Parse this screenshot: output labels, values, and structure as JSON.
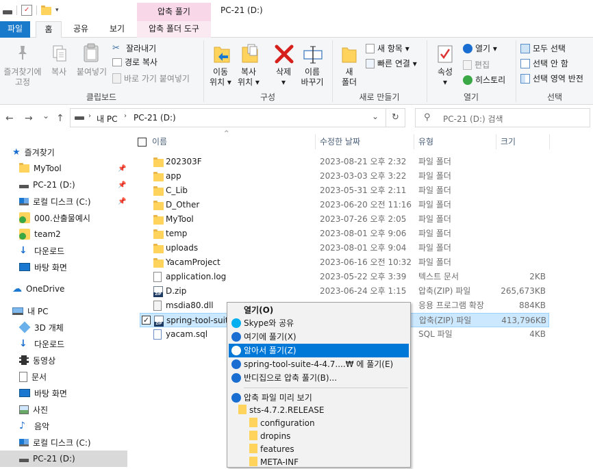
{
  "window": {
    "context_tab_group": "압축 풀기",
    "title": "PC-21 (D:)"
  },
  "tabs": [
    {
      "label": "파일"
    },
    {
      "label": "홈"
    },
    {
      "label": "공유"
    },
    {
      "label": "보기"
    },
    {
      "label": "압축 폴더 도구"
    }
  ],
  "ribbon": {
    "clipboard": {
      "pin_line1": "즐겨찾기에",
      "pin_line2": "고정",
      "copy": "복사",
      "paste": "붙여넣기",
      "cut": "잘라내기",
      "copy_path": "경로 복사",
      "paste_shortcut": "바로 가기 붙여넣기",
      "group": "클립보드"
    },
    "organize": {
      "move_line1": "이동",
      "move_line2": "위치 ▾",
      "copyto_line1": "복사",
      "copyto_line2": "위치 ▾",
      "delete_line1": "삭제",
      "delete_line2": "▾",
      "rename_line1": "이름",
      "rename_line2": "바꾸기",
      "group": "구성"
    },
    "new": {
      "folder_line1": "새",
      "folder_line2": "폴더",
      "new_item": "새 항목 ▾",
      "easy_access": "빠른 연결 ▾",
      "group": "새로 만들기"
    },
    "open": {
      "props_line1": "속성",
      "props_line2": "▾",
      "open": "열기 ▾",
      "edit": "편집",
      "history": "히스토리",
      "group": "열기"
    },
    "select": {
      "select_all": "모두 선택",
      "select_none": "선택 안 함",
      "invert": "선택 영역 반전",
      "group": "선택"
    }
  },
  "address": {
    "back": "←",
    "forward": "→",
    "recent": "⌄",
    "up": "↑",
    "crumb1": "내 PC",
    "crumb2": "PC-21 (D:)",
    "dropdown": "⌄",
    "refresh": "↻",
    "search_placeholder": "PC-21 (D:) 검색"
  },
  "nav": {
    "quick_access": "즐겨찾기",
    "items": [
      {
        "label": "MyTool"
      },
      {
        "label": "PC-21 (D:)"
      },
      {
        "label": "로컬 디스크 (C:)"
      },
      {
        "label": "000.산출물예시"
      },
      {
        "label": "team2"
      },
      {
        "label": "다운로드"
      },
      {
        "label": "바탕 화면"
      }
    ],
    "onedrive": "OneDrive",
    "thispc": "내 PC",
    "pc_items": [
      {
        "label": "3D 개체"
      },
      {
        "label": "다운로드"
      },
      {
        "label": "동영상"
      },
      {
        "label": "문서"
      },
      {
        "label": "바탕 화면"
      },
      {
        "label": "사진"
      },
      {
        "label": "음악"
      },
      {
        "label": "로컬 디스크 (C:)"
      },
      {
        "label": "PC-21 (D:)"
      }
    ]
  },
  "columns": {
    "name": "이름",
    "date": "수정한 날짜",
    "type": "유형",
    "size": "크기"
  },
  "files": [
    {
      "name": "202303F",
      "date": "2023-08-21 오후 2:32",
      "type": "파일 폴더",
      "size": ""
    },
    {
      "name": "app",
      "date": "2023-03-03 오후 3:22",
      "type": "파일 폴더",
      "size": ""
    },
    {
      "name": "C_Lib",
      "date": "2023-05-31 오후 2:11",
      "type": "파일 폴더",
      "size": ""
    },
    {
      "name": "D_Other",
      "date": "2023-06-20 오전 11:16",
      "type": "파일 폴더",
      "size": ""
    },
    {
      "name": "MyTool",
      "date": "2023-07-26 오후 2:05",
      "type": "파일 폴더",
      "size": ""
    },
    {
      "name": "temp",
      "date": "2023-08-01 오후 9:06",
      "type": "파일 폴더",
      "size": ""
    },
    {
      "name": "uploads",
      "date": "2023-08-01 오후 9:04",
      "type": "파일 폴더",
      "size": ""
    },
    {
      "name": "YacamProject",
      "date": "2023-06-16 오전 10:32",
      "type": "파일 폴더",
      "size": ""
    },
    {
      "name": "application.log",
      "date": "2023-05-22 오후 3:39",
      "type": "텍스트 문서",
      "size": "2KB"
    },
    {
      "name": "D.zip",
      "date": "2023-06-24 오후 1:15",
      "type": "압축(ZIP) 파일",
      "size": "265,673KB"
    },
    {
      "name": "msdia80.dll",
      "date": "",
      "type": "응용 프로그램 확장",
      "size": "884KB"
    },
    {
      "name": "spring-tool-suite",
      "date": "",
      "type": "압축(ZIP) 파일",
      "size": "413,796KB"
    },
    {
      "name": "yacam.sql",
      "date": "",
      "type": "SQL 파일",
      "size": "4KB"
    }
  ],
  "context_menu": {
    "open": "열기(O)",
    "skype": "Skype와 공유",
    "extract_here": "여기에 풀기(X)",
    "smart_extract": "알아서 풀기(Z)",
    "extract_to": "spring-tool-suite-4-4.7....₩ 에 풀기(E)",
    "bandizip_compress": "반디집으로 압축 풀기(B)...",
    "preview": "압축 파일 미리 보기",
    "tree": [
      {
        "label": "sts-4.7.2.RELEASE"
      },
      {
        "label": "configuration"
      },
      {
        "label": "dropins"
      },
      {
        "label": "features"
      },
      {
        "label": "META-INF"
      }
    ]
  },
  "colors": {
    "file_tab": "#1979ca",
    "context_band": "#f8d7e8",
    "selection": "#cce8ff",
    "menu_highlight": "#0078d7"
  }
}
